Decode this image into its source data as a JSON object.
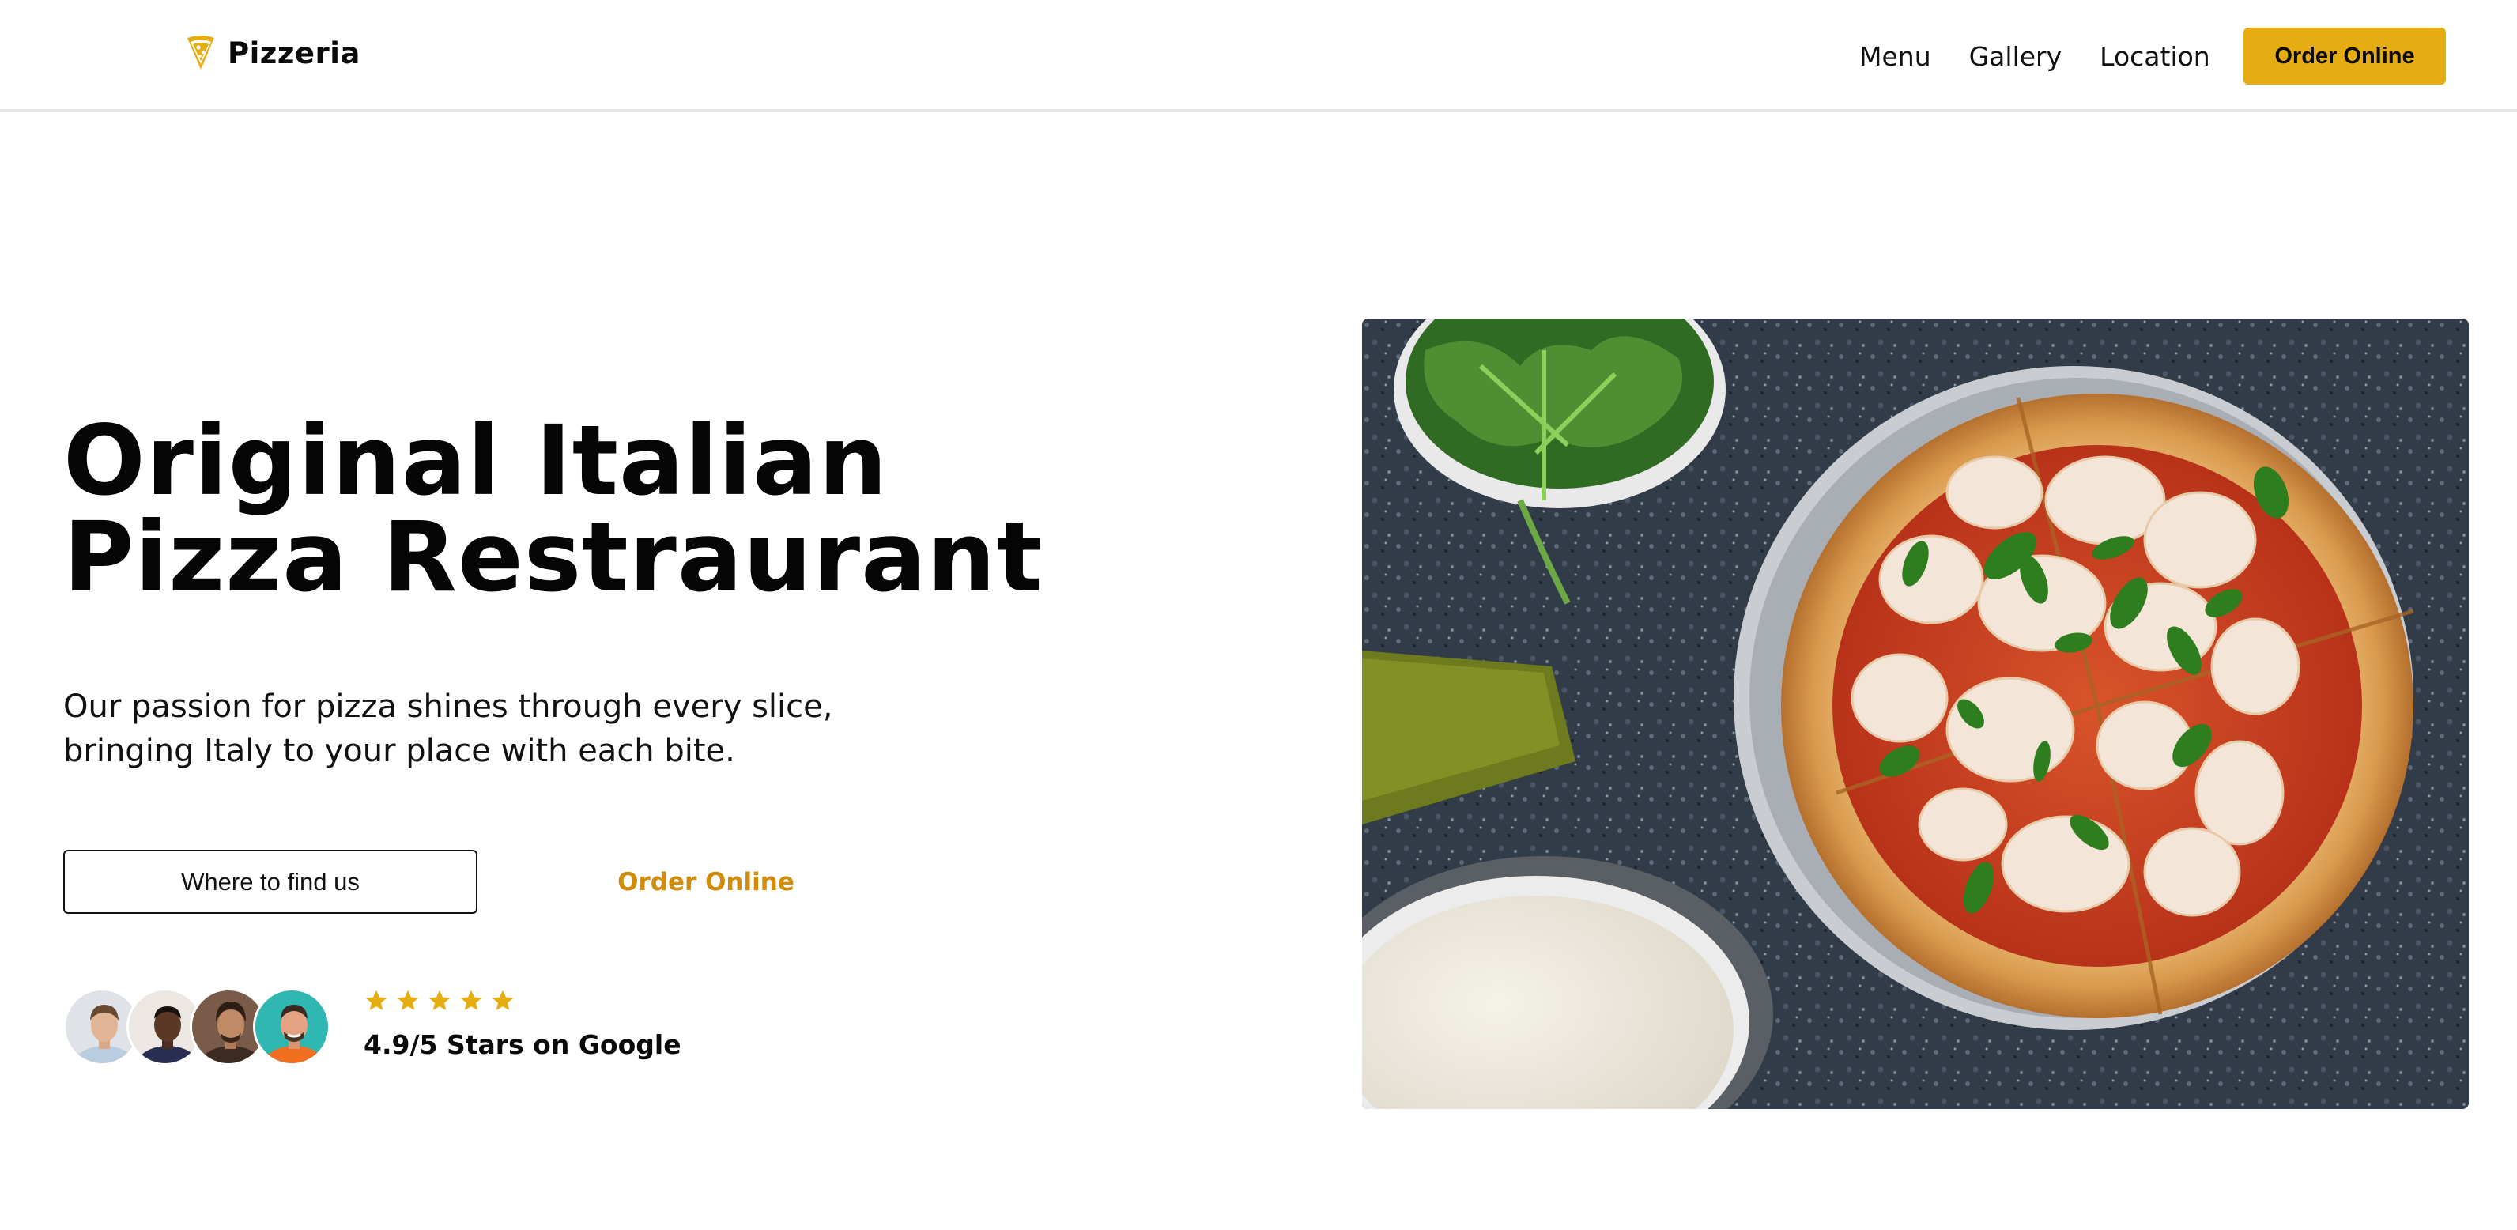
{
  "brand": {
    "name": "Pizzeria",
    "icon": "pizza-slice-icon",
    "accent_color": "#e6ad12"
  },
  "nav": {
    "links": [
      "Menu",
      "Gallery",
      "Location"
    ],
    "cta_label": "Order Online"
  },
  "hero": {
    "title_line_1": "Original Italian",
    "title_line_2": "Pizza Restraurant",
    "description_line_1": "Our passion for pizza shines through every slice,",
    "description_line_2": "bringing Italy to your place with each bite.",
    "primary_button_label": "Where to find us",
    "secondary_button_label": "Order Online",
    "secondary_button_color": "#cf8d0b"
  },
  "social_proof": {
    "avatar_count": 4,
    "stars": 5,
    "star_color": "#e6ad12",
    "rating_text": "4.9/5 Stars on Google"
  },
  "image": {
    "icon": "pizza-photo"
  }
}
